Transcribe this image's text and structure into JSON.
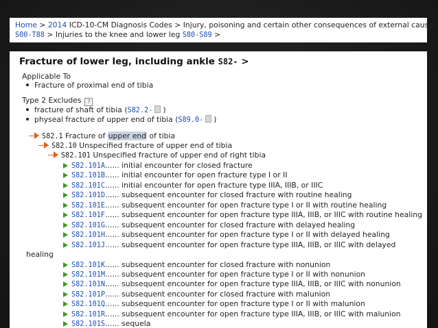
{
  "breadcrumb": {
    "home": "Home",
    "year": "2014",
    "book": "ICD-10-CM Diagnosis Codes",
    "sep": " > ",
    "chapter": "Injury, poisoning and certain other consequences of external causes",
    "range1_code": "S00-T88",
    "range1_label": "Injuries to the knee and lower leg",
    "range2_code": "S80-S89",
    "trail": ">"
  },
  "page": {
    "title": "Fracture of lower leg, including ankle",
    "title_code": "S82-",
    "title_arrow": ">"
  },
  "applicable_to": {
    "heading": "Applicable To",
    "items": [
      "Fracture of proximal end of tibia"
    ]
  },
  "type2_excludes": {
    "heading": "Type 2 Excludes",
    "help": "?",
    "items": [
      {
        "text": "fracture of shaft of tibia (",
        "code": "S82.2-",
        "close": ")"
      },
      {
        "text": "physeal fracture of upper end of tibia (",
        "code": "S89.0-",
        "close": ")"
      }
    ]
  },
  "tree": {
    "level1": {
      "code": "S82.1",
      "label_pre": "Fracture of ",
      "label_hl": "upper end",
      "label_post": " of tibia"
    },
    "level2": {
      "code": "S82.10",
      "label": "Unspecified fracture of upper end of tibia"
    },
    "level3": {
      "code": "S82.101",
      "label": "Unspecified fracture of upper end of right tibia"
    },
    "codes": [
      {
        "code": "S82.101A",
        "desc": "initial encounter for closed fracture"
      },
      {
        "code": "S82.101B",
        "desc": "initial encounter for open fracture type I or II"
      },
      {
        "code": "S82.101C",
        "desc": "initial encounter for open fracture type IIIA, IIIB, or IIIC"
      },
      {
        "code": "S82.101D",
        "desc": "subsequent encounter for closed fracture with routine healing"
      },
      {
        "code": "S82.101E",
        "desc": "subsequent encounter for open fracture type I or II with routine healing"
      },
      {
        "code": "S82.101F",
        "desc": "subsequent encounter for open fracture type IIIA, IIIB, or IIIC with routine healing"
      },
      {
        "code": "S82.101G",
        "desc": "subsequent encounter for closed fracture with delayed healing"
      },
      {
        "code": "S82.101H",
        "desc": "subsequent encounter for open fracture type I or II with delayed healing"
      },
      {
        "code": "S82.101J",
        "desc": "subsequent encounter for open fracture type IIIA, IIIB, or IIIC with delayed"
      },
      {
        "code": "S82.101K",
        "desc": "subsequent encounter for closed fracture with nonunion"
      },
      {
        "code": "S82.101M",
        "desc": "subsequent encounter for open fracture type I or II with nonunion"
      },
      {
        "code": "S82.101N",
        "desc": "subsequent encounter for open fracture type IIIA, IIIB, or IIIC with nonunion"
      },
      {
        "code": "S82.101P",
        "desc": "subsequent encounter for closed fracture with malunion"
      },
      {
        "code": "S82.101Q",
        "desc": "subsequent encounter for open fracture type I or II with malunion"
      },
      {
        "code": "S82.101R",
        "desc": "subsequent encounter for open fracture type IIIA, IIIB, or IIIC with malunion"
      },
      {
        "code": "S82.101S",
        "desc": "sequela"
      }
    ],
    "dots": "......",
    "wrap_text": "healing"
  },
  "colors": {
    "link": "#1b4eb5",
    "expand_arrow": "#e0621f",
    "leaf_arrow": "#3a9a1c"
  }
}
